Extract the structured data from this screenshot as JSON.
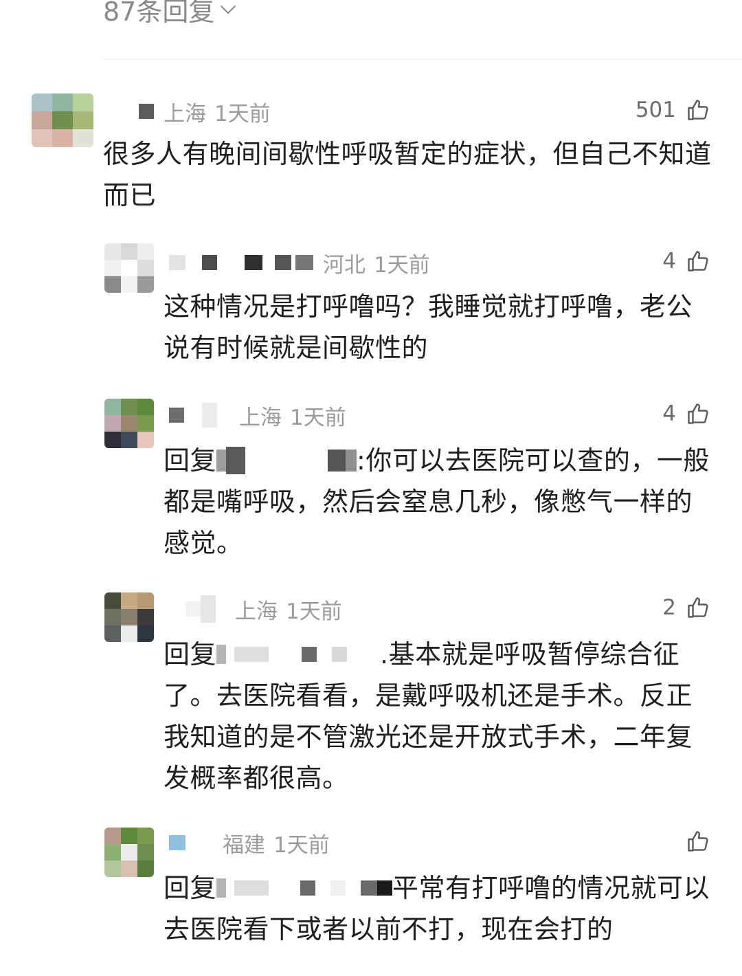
{
  "header": {
    "reply_count_label": "87条回复"
  },
  "comments": [
    {
      "location": "上海",
      "time": "1天前",
      "likes": "501",
      "text": "很多人有晚间间歇性呼吸暂定的症状，但自己不知道而已"
    },
    {
      "location": "河北",
      "time": "1天前",
      "likes": "4",
      "text": "这种情况是打呼噜吗？我睡觉就打呼噜，老公说有时候就是间歇性的"
    },
    {
      "location": "上海",
      "time": "1天前",
      "likes": "4",
      "reply_prefix": "回复",
      "text": ":你可以去医院可以查的，一般都是嘴呼吸，然后会窒息几秒，像憋气一样的感觉。"
    },
    {
      "location": "上海",
      "time": "1天前",
      "likes": "2",
      "reply_prefix": "回复",
      "text": ".基本就是呼吸暂停综合征了。去医院看看，是戴呼吸机还是手术。反正我知道的是不管激光还是开放式手术，二年复发概率都很高。"
    },
    {
      "location": "福建",
      "time": "1天前",
      "likes": "",
      "reply_prefix": "回复",
      "text": "平常有打呼噜的情况就可以去医院看下或者以前不打，现在会打的"
    }
  ],
  "colors": {
    "text": "#1f1f1f",
    "meta": "#9b9b9b",
    "like": "#6b6b6b",
    "divider": "#ededed"
  },
  "icons": {
    "like": "thumbs-up-icon",
    "expand": "chevron-down-icon"
  }
}
